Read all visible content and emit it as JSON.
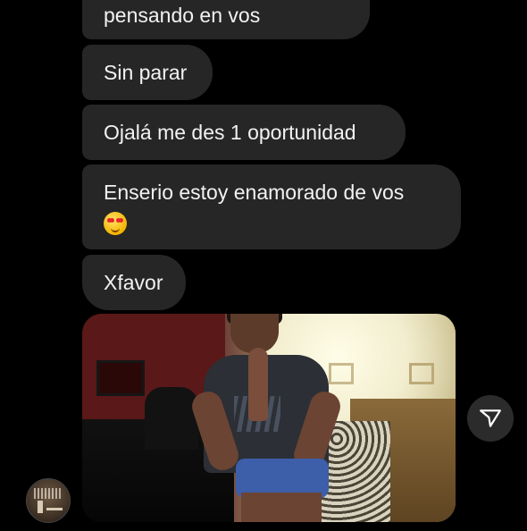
{
  "messages": [
    {
      "text": "pensando en vos"
    },
    {
      "text": "Sin parar"
    },
    {
      "text": "Ojalá me des 1 oportunidad"
    },
    {
      "text": "Enserio estoy enamorado de vos",
      "emoji": "smiling-face-with-heart-eyes"
    },
    {
      "text": "Xfavor"
    }
  ],
  "photo": {
    "description_icon": "photo-message"
  },
  "share": {
    "icon": "send-paper-plane-icon"
  },
  "avatar": {
    "icon": "user-avatar"
  },
  "colors": {
    "background": "#000000",
    "bubble": "#262626",
    "text": "#f2f2f2"
  }
}
